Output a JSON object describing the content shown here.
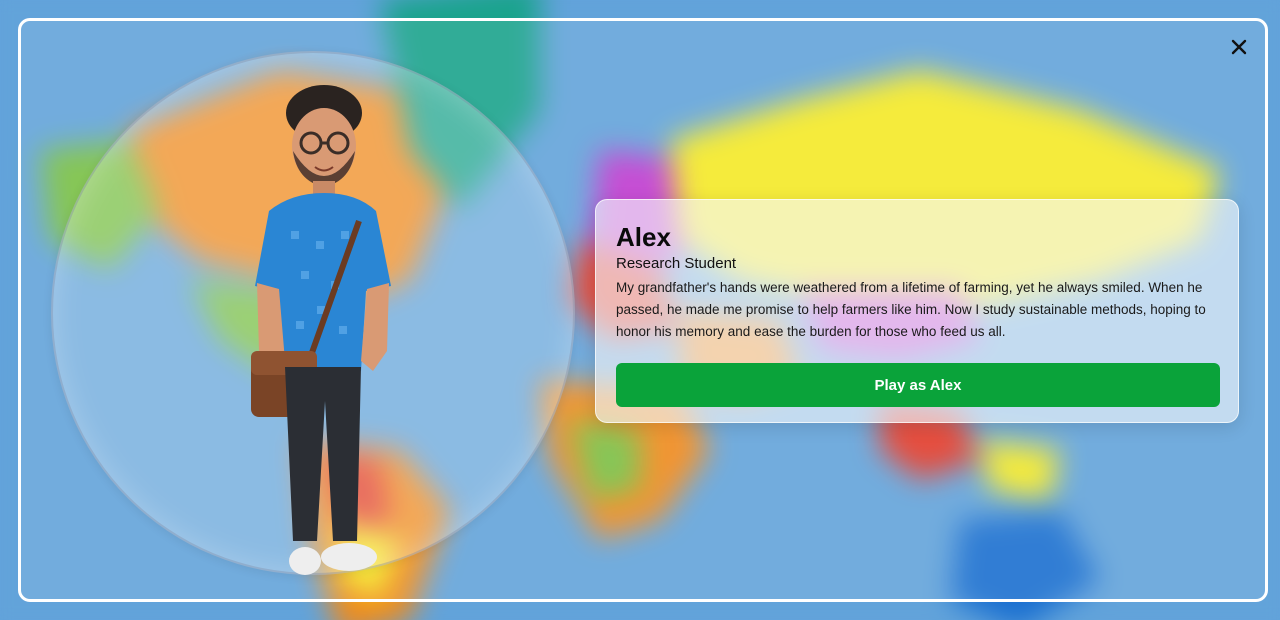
{
  "background": {
    "icon": "world-map-icon",
    "colors": {
      "ocean": "#62a3da",
      "yellow": "#f4e926",
      "orange": "#f08a1c",
      "teal": "#1aa38c",
      "green": "#79c044",
      "magenta": "#c03ad0",
      "red": "#e23b2a"
    }
  },
  "modal": {
    "close_icon": "close-icon",
    "border_color": "#ffffff"
  },
  "character": {
    "portrait_icon": "character-avatar-icon",
    "name": "Alex",
    "role": "Research Student",
    "story": "My grandfather's hands were weathered from a lifetime of farming, yet he always smiled. When he passed, he made me promise to help farmers like him. Now I study sustainable methods, hoping to honor his memory and ease the burden for those who feed us all.",
    "play_label": "Play as Alex",
    "accent": "#0aa33a"
  }
}
